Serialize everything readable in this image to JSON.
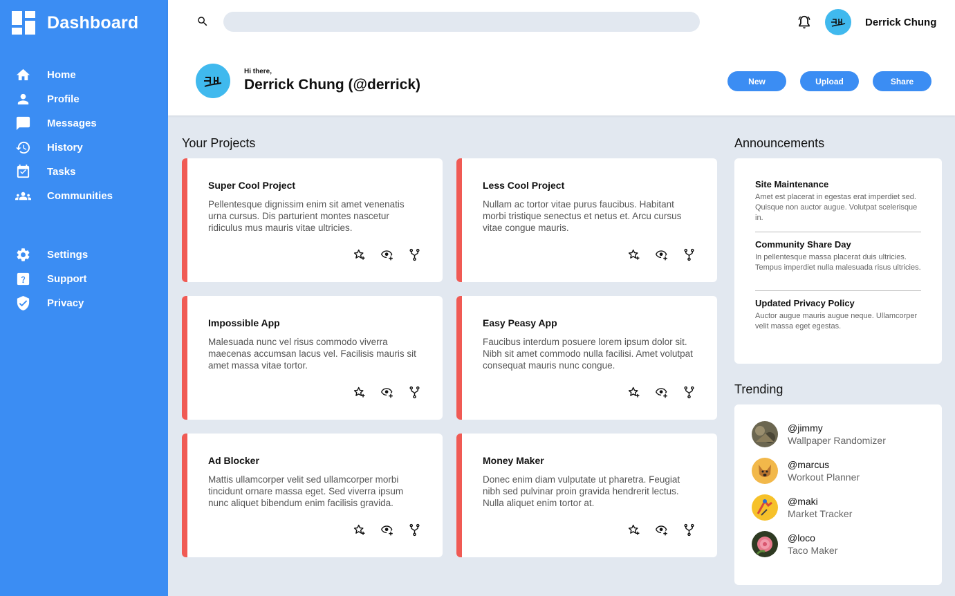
{
  "sidebar": {
    "brand": "Dashboard",
    "items": [
      {
        "label": "Home",
        "icon": "home-icon"
      },
      {
        "label": "Profile",
        "icon": "person-icon"
      },
      {
        "label": "Messages",
        "icon": "chat-icon"
      },
      {
        "label": "History",
        "icon": "history-icon"
      },
      {
        "label": "Tasks",
        "icon": "calendar-check-icon"
      },
      {
        "label": "Communities",
        "icon": "group-icon"
      }
    ],
    "secondary": [
      {
        "label": "Settings",
        "icon": "gear-icon"
      },
      {
        "label": "Support",
        "icon": "help-icon"
      },
      {
        "label": "Privacy",
        "icon": "shield-check-icon"
      }
    ]
  },
  "header": {
    "search_placeholder": "",
    "user_name": "Derrick Chung",
    "greeting": "Hi there,",
    "full_name": "Derrick Chung (@derrick)",
    "buttons": {
      "new": "New",
      "upload": "Upload",
      "share": "Share"
    }
  },
  "projects": {
    "title": "Your Projects",
    "items": [
      {
        "title": "Super Cool Project",
        "desc": "Pellentesque dignissim enim sit amet venenatis urna cursus. Dis parturient montes nascetur ridiculus mus mauris vitae ultricies."
      },
      {
        "title": "Less Cool Project",
        "desc": "Nullam ac tortor vitae purus faucibus. Habitant morbi tristique senectus et netus et. Arcu cursus vitae congue mauris."
      },
      {
        "title": "Impossible App",
        "desc": "Malesuada nunc vel risus commodo viverra maecenas accumsan lacus vel. Facilisis mauris sit amet massa vitae tortor."
      },
      {
        "title": "Easy Peasy App",
        "desc": "Faucibus interdum posuere lorem ipsum dolor sit. Nibh sit amet commodo nulla facilisi. Amet volutpat consequat mauris nunc congue."
      },
      {
        "title": "Ad Blocker",
        "desc": "Mattis ullamcorper velit sed ullamcorper morbi tincidunt ornare massa eget. Sed viverra ipsum nunc aliquet bibendum enim facilisis gravida."
      },
      {
        "title": "Money Maker",
        "desc": "Donec enim diam vulputate ut pharetra. Feugiat nibh sed pulvinar proin gravida hendrerit lectus. Nulla aliquet enim tortor at."
      }
    ]
  },
  "announcements": {
    "title": "Announcements",
    "items": [
      {
        "title": "Site Maintenance",
        "body": "Amet est placerat in egestas erat imperdiet sed. Quisque non auctor augue. Volutpat scelerisque in."
      },
      {
        "title": "Community Share Day",
        "body": "In pellentesque massa placerat duis ultricies. Tempus imperdiet nulla malesuada risus ultricies."
      },
      {
        "title": "Updated Privacy Policy",
        "body": "Auctor augue mauris augue neque. Ullamcorper velit massa eget egestas."
      }
    ]
  },
  "trending": {
    "title": "Trending",
    "items": [
      {
        "handle": "@jimmy",
        "project": "Wallpaper Randomizer"
      },
      {
        "handle": "@marcus",
        "project": "Workout Planner"
      },
      {
        "handle": "@maki",
        "project": "Market Tracker"
      },
      {
        "handle": "@loco",
        "project": "Taco Maker"
      }
    ]
  },
  "colors": {
    "accent": "#3b8df3",
    "card_stripe": "#f05a54",
    "background": "#e2e8f0",
    "avatar_bg": "#40b9ee"
  }
}
